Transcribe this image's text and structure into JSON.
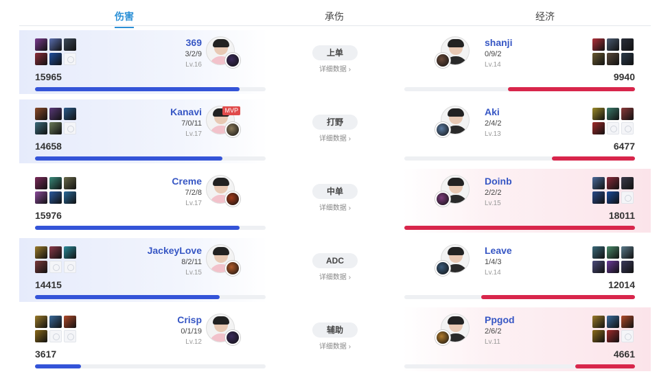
{
  "tabs": [
    {
      "label": "伤害",
      "active": true
    },
    {
      "label": "承伤",
      "active": false
    },
    {
      "label": "经济",
      "active": false
    }
  ],
  "detail_label": "详细数据 ›",
  "colors": {
    "blue_accent": "#3454d8",
    "red_accent": "#d8264b",
    "tab_active": "#2a8fd6"
  },
  "max_damage": 18011,
  "rows": [
    {
      "role": "上单",
      "left": {
        "name": "369",
        "kda": "3/2/9",
        "level": "Lv.16",
        "damage": "15965",
        "damage_value": 15965,
        "mvp": false,
        "win": true,
        "items": [
          "#7a3b8f",
          "#5a6fb0",
          "#3d4a5a",
          "#8a2e3a",
          "#1f4fa0",
          "empty"
        ],
        "champ_color": "#3b2a5a",
        "avatar": "pink"
      },
      "right": {
        "name": "shanji",
        "kda": "0/9/2",
        "level": "Lv.14",
        "damage": "9940",
        "damage_value": 9940,
        "mvp": false,
        "win": false,
        "items": [
          "#b0303a",
          "#4a5a70",
          "#2a2f3a",
          "#6a5a30",
          "#5a4a3a",
          "#2a3a4a"
        ],
        "champ_color": "#6a4a3a",
        "avatar": "dark"
      }
    },
    {
      "role": "打野",
      "left": {
        "name": "Kanavi",
        "kda": "7/0/11",
        "level": "Lv.17",
        "damage": "14658",
        "damage_value": 14658,
        "mvp": true,
        "mvp_label": "MVP",
        "win": true,
        "items": [
          "#8a4a2a",
          "#5a3a7a",
          "#2a5a8a",
          "#3a6a7a",
          "#6a7a5a",
          "empty"
        ],
        "champ_color": "#8a7a5a",
        "avatar": "pink"
      },
      "right": {
        "name": "Aki",
        "kda": "2/4/2",
        "level": "Lv.13",
        "damage": "6477",
        "damage_value": 6477,
        "mvp": false,
        "win": false,
        "items": [
          "#9a8a2a",
          "#3a7a6a",
          "#8a3a3a",
          "#a02a2a",
          "empty",
          "empty"
        ],
        "champ_color": "#5a7aa0",
        "avatar": "dark"
      }
    },
    {
      "role": "中单",
      "left": {
        "name": "Creme",
        "kda": "7/2/8",
        "level": "Lv.17",
        "damage": "15976",
        "damage_value": 15976,
        "mvp": false,
        "win": false,
        "items": [
          "#7a2a5a",
          "#3a8a7a",
          "#6a6a4a",
          "#8a4a9a",
          "#2a5aa0",
          "#2a6a9a"
        ],
        "champ_color": "#a03a1a",
        "avatar": "pink"
      },
      "right": {
        "name": "Doinb",
        "kda": "2/2/2",
        "level": "Lv.15",
        "damage": "18011",
        "damage_value": 18011,
        "mvp": false,
        "win": true,
        "items": [
          "#4a6a9a",
          "#8a2a3a",
          "#3a3a4a",
          "#2a4a8a",
          "#1a4a9a",
          "empty"
        ],
        "champ_color": "#7a3a7a",
        "avatar": "dark"
      }
    },
    {
      "role": "ADC",
      "left": {
        "name": "JackeyLove",
        "kda": "8/2/11",
        "level": "Lv.15",
        "damage": "14415",
        "damage_value": 14415,
        "mvp": false,
        "win": true,
        "items": [
          "#9a7a2a",
          "#8a3a4a",
          "#2a8a9a",
          "#7a3a3a",
          "empty",
          "empty"
        ],
        "champ_color": "#b05a2a",
        "avatar": "pink"
      },
      "right": {
        "name": "Leave",
        "kda": "1/4/3",
        "level": "Lv.14",
        "damage": "12014",
        "damage_value": 12014,
        "mvp": false,
        "win": false,
        "items": [
          "#3a6a7a",
          "#4a8a6a",
          "#5a7a8a",
          "#4a4a7a",
          "#6a3a9a",
          "#3a3a5a"
        ],
        "champ_color": "#3a5a7a",
        "avatar": "dark"
      }
    },
    {
      "role": "辅助",
      "left": {
        "name": "Crisp",
        "kda": "0/1/19",
        "level": "Lv.12",
        "damage": "3617",
        "damage_value": 3617,
        "mvp": false,
        "win": false,
        "items": [
          "#9a7a2a",
          "#3a6a9a",
          "#b04a2a",
          "#8a6a1a",
          "empty",
          "empty"
        ],
        "champ_color": "#3a2a5a",
        "avatar": "pink"
      },
      "right": {
        "name": "Ppgod",
        "kda": "2/6/2",
        "level": "Lv.11",
        "damage": "4661",
        "damage_value": 4661,
        "mvp": false,
        "win": true,
        "items": [
          "#9a7a2a",
          "#3a6a9a",
          "#b04a2a",
          "#8a6a1a",
          "#a02a2a",
          "empty"
        ],
        "champ_color": "#b07a2a",
        "avatar": "dark"
      }
    }
  ]
}
